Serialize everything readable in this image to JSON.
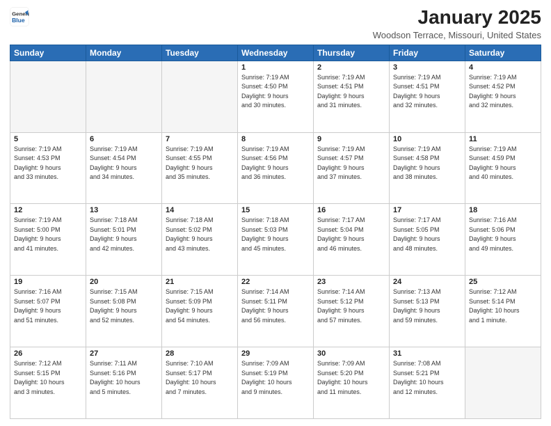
{
  "header": {
    "logo_line1": "General",
    "logo_line2": "Blue",
    "main_title": "January 2025",
    "subtitle": "Woodson Terrace, Missouri, United States"
  },
  "weekdays": [
    "Sunday",
    "Monday",
    "Tuesday",
    "Wednesday",
    "Thursday",
    "Friday",
    "Saturday"
  ],
  "weeks": [
    [
      {
        "day": "",
        "info": ""
      },
      {
        "day": "",
        "info": ""
      },
      {
        "day": "",
        "info": ""
      },
      {
        "day": "1",
        "info": "Sunrise: 7:19 AM\nSunset: 4:50 PM\nDaylight: 9 hours\nand 30 minutes."
      },
      {
        "day": "2",
        "info": "Sunrise: 7:19 AM\nSunset: 4:51 PM\nDaylight: 9 hours\nand 31 minutes.",
        "highlight": true
      },
      {
        "day": "3",
        "info": "Sunrise: 7:19 AM\nSunset: 4:51 PM\nDaylight: 9 hours\nand 32 minutes."
      },
      {
        "day": "4",
        "info": "Sunrise: 7:19 AM\nSunset: 4:52 PM\nDaylight: 9 hours\nand 32 minutes."
      }
    ],
    [
      {
        "day": "5",
        "info": "Sunrise: 7:19 AM\nSunset: 4:53 PM\nDaylight: 9 hours\nand 33 minutes."
      },
      {
        "day": "6",
        "info": "Sunrise: 7:19 AM\nSunset: 4:54 PM\nDaylight: 9 hours\nand 34 minutes."
      },
      {
        "day": "7",
        "info": "Sunrise: 7:19 AM\nSunset: 4:55 PM\nDaylight: 9 hours\nand 35 minutes."
      },
      {
        "day": "8",
        "info": "Sunrise: 7:19 AM\nSunset: 4:56 PM\nDaylight: 9 hours\nand 36 minutes."
      },
      {
        "day": "9",
        "info": "Sunrise: 7:19 AM\nSunset: 4:57 PM\nDaylight: 9 hours\nand 37 minutes.",
        "highlight": true
      },
      {
        "day": "10",
        "info": "Sunrise: 7:19 AM\nSunset: 4:58 PM\nDaylight: 9 hours\nand 38 minutes."
      },
      {
        "day": "11",
        "info": "Sunrise: 7:19 AM\nSunset: 4:59 PM\nDaylight: 9 hours\nand 40 minutes."
      }
    ],
    [
      {
        "day": "12",
        "info": "Sunrise: 7:19 AM\nSunset: 5:00 PM\nDaylight: 9 hours\nand 41 minutes."
      },
      {
        "day": "13",
        "info": "Sunrise: 7:18 AM\nSunset: 5:01 PM\nDaylight: 9 hours\nand 42 minutes."
      },
      {
        "day": "14",
        "info": "Sunrise: 7:18 AM\nSunset: 5:02 PM\nDaylight: 9 hours\nand 43 minutes."
      },
      {
        "day": "15",
        "info": "Sunrise: 7:18 AM\nSunset: 5:03 PM\nDaylight: 9 hours\nand 45 minutes."
      },
      {
        "day": "16",
        "info": "Sunrise: 7:17 AM\nSunset: 5:04 PM\nDaylight: 9 hours\nand 46 minutes.",
        "highlight": true
      },
      {
        "day": "17",
        "info": "Sunrise: 7:17 AM\nSunset: 5:05 PM\nDaylight: 9 hours\nand 48 minutes."
      },
      {
        "day": "18",
        "info": "Sunrise: 7:16 AM\nSunset: 5:06 PM\nDaylight: 9 hours\nand 49 minutes."
      }
    ],
    [
      {
        "day": "19",
        "info": "Sunrise: 7:16 AM\nSunset: 5:07 PM\nDaylight: 9 hours\nand 51 minutes."
      },
      {
        "day": "20",
        "info": "Sunrise: 7:15 AM\nSunset: 5:08 PM\nDaylight: 9 hours\nand 52 minutes."
      },
      {
        "day": "21",
        "info": "Sunrise: 7:15 AM\nSunset: 5:09 PM\nDaylight: 9 hours\nand 54 minutes."
      },
      {
        "day": "22",
        "info": "Sunrise: 7:14 AM\nSunset: 5:11 PM\nDaylight: 9 hours\nand 56 minutes."
      },
      {
        "day": "23",
        "info": "Sunrise: 7:14 AM\nSunset: 5:12 PM\nDaylight: 9 hours\nand 57 minutes.",
        "highlight": true
      },
      {
        "day": "24",
        "info": "Sunrise: 7:13 AM\nSunset: 5:13 PM\nDaylight: 9 hours\nand 59 minutes."
      },
      {
        "day": "25",
        "info": "Sunrise: 7:12 AM\nSunset: 5:14 PM\nDaylight: 10 hours\nand 1 minute."
      }
    ],
    [
      {
        "day": "26",
        "info": "Sunrise: 7:12 AM\nSunset: 5:15 PM\nDaylight: 10 hours\nand 3 minutes."
      },
      {
        "day": "27",
        "info": "Sunrise: 7:11 AM\nSunset: 5:16 PM\nDaylight: 10 hours\nand 5 minutes."
      },
      {
        "day": "28",
        "info": "Sunrise: 7:10 AM\nSunset: 5:17 PM\nDaylight: 10 hours\nand 7 minutes."
      },
      {
        "day": "29",
        "info": "Sunrise: 7:09 AM\nSunset: 5:19 PM\nDaylight: 10 hours\nand 9 minutes."
      },
      {
        "day": "30",
        "info": "Sunrise: 7:09 AM\nSunset: 5:20 PM\nDaylight: 10 hours\nand 11 minutes.",
        "highlight": true
      },
      {
        "day": "31",
        "info": "Sunrise: 7:08 AM\nSunset: 5:21 PM\nDaylight: 10 hours\nand 12 minutes."
      },
      {
        "day": "",
        "info": ""
      }
    ]
  ]
}
